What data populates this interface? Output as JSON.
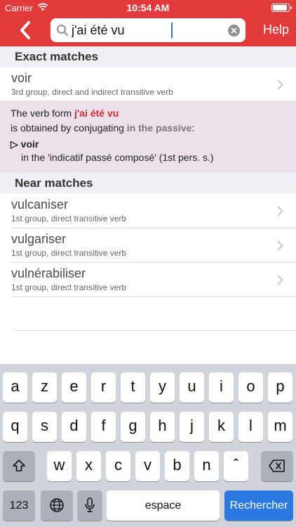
{
  "status": {
    "carrier": "Carrier",
    "time": "10:54 AM"
  },
  "nav": {
    "search_value": "j'ai été vu",
    "help_label": "Help"
  },
  "exact": {
    "header": "Exact matches",
    "item": {
      "title": "voir",
      "subtitle": "3rd group, direct and indirect transitive verb"
    }
  },
  "info": {
    "line1_prefix": "The verb form ",
    "line1_form": "j'ai été vu",
    "line2_prefix": "is obtained by conjugating ",
    "line2_mode": "in the passive",
    "line2_suffix": ":",
    "bullet_symbol": "▷",
    "bullet_verb": "voir",
    "detail": "in the 'indicatif passé composé' (1st pers. s.)"
  },
  "near": {
    "header": "Near matches",
    "items": [
      {
        "title": "vulcaniser",
        "subtitle": "1st group, direct transitive verb"
      },
      {
        "title": "vulgariser",
        "subtitle": "1st group, direct transitive verb"
      },
      {
        "title": "vulnérabiliser",
        "subtitle": "1st group, direct transitive verb"
      }
    ]
  },
  "keyboard": {
    "row1": [
      "a",
      "z",
      "e",
      "r",
      "t",
      "y",
      "u",
      "i",
      "o",
      "p"
    ],
    "row2": [
      "q",
      "s",
      "d",
      "f",
      "g",
      "h",
      "j",
      "k",
      "l",
      "m"
    ],
    "row3": [
      "w",
      "x",
      "c",
      "v",
      "b",
      "n",
      "ˆ"
    ],
    "numbers_label": "123",
    "space_label": "espace",
    "search_label": "Rechercher"
  },
  "colors": {
    "accent": "#e2393b",
    "info_bg": "#ece0ea",
    "highlight": "#d02a33",
    "keyboard_action": "#2b79e0"
  }
}
